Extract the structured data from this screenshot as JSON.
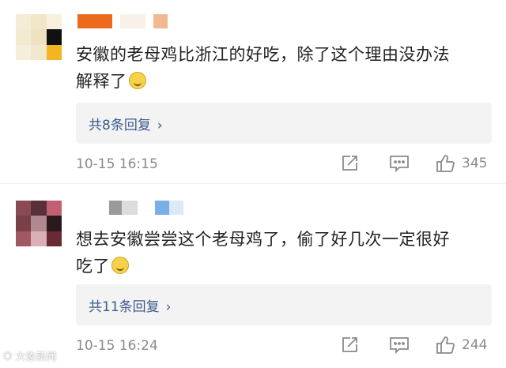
{
  "comments": [
    {
      "text_line1": "安徽的老母鸡比浙江的好吃，除了这个理由没办法",
      "text_line2": "解释了",
      "emoji": "laugh-emoji",
      "replies_label": "共8条回复",
      "timestamp": "10-15 16:15",
      "likes": "345"
    },
    {
      "text_line1": "想去安徽尝尝这个老母鸡了，偷了好几次一定很好",
      "text_line2": "吃了",
      "emoji": "smile-emoji",
      "replies_label": "共11条回复",
      "timestamp": "10-15 16:24",
      "likes": "244"
    }
  ],
  "ui": {
    "chevron": "›"
  },
  "watermark": "大象新闻",
  "colors": {
    "link": "#3b5b8c",
    "meta": "#8a8a8a",
    "reply_bg": "#f3f3f3"
  }
}
